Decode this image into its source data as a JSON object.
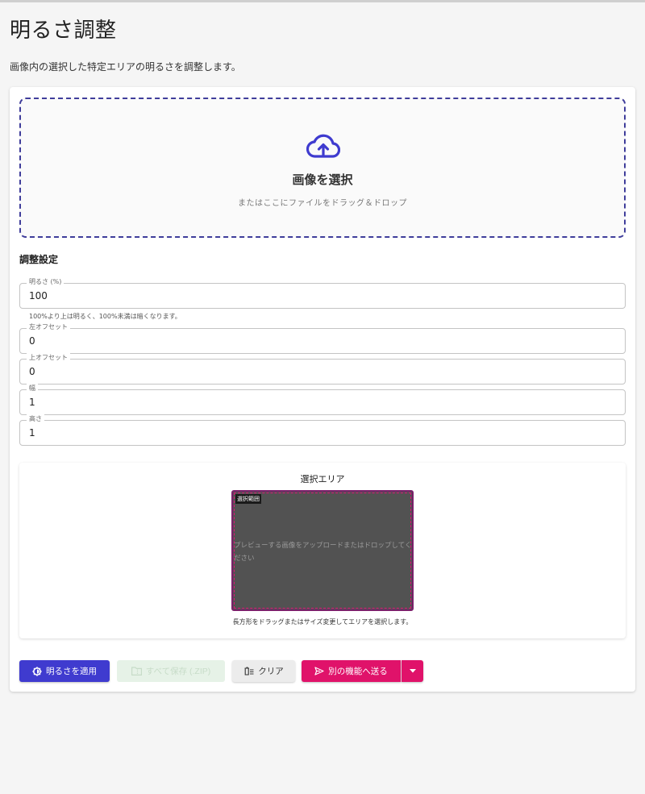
{
  "page": {
    "title": "明るさ調整",
    "description": "画像内の選択した特定エリアの明るさを調整します。"
  },
  "dropzone": {
    "icon": "cloud-upload-icon",
    "title": "画像を選択",
    "subtitle": "またはここにファイルをドラッグ＆ドロップ"
  },
  "settings": {
    "title": "調整設定",
    "fields": [
      {
        "label": "明るさ (%)",
        "value": "100"
      },
      {
        "label": "左オフセット",
        "value": "0"
      },
      {
        "label": "上オフセット",
        "value": "0"
      },
      {
        "label": "幅",
        "value": "1"
      },
      {
        "label": "高さ",
        "value": "1"
      }
    ],
    "brightness_helper": "100%より上は明るく、100%未満は暗くなります。"
  },
  "area": {
    "title": "選択エリア",
    "selection_tag": "選択範囲",
    "preview_message": "プレビューする画像をアップロードまたはドロップしてください",
    "hint": "長方形をドラッグまたはサイズ変更してエリアを選択します。"
  },
  "actions": {
    "apply_label": "明るさを適用",
    "save_label": "すべて保存 (.ZIP)",
    "clear_label": "クリア",
    "send_label": "別の機能へ送る"
  },
  "colors": {
    "primary": "#3f3bcf",
    "accent": "#e0126a",
    "dropzone_border": "#3f3d9b",
    "preview_bg": "#525252"
  }
}
